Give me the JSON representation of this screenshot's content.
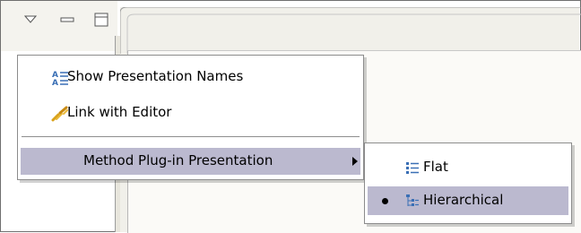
{
  "view_toolbar": {
    "menu_icon": "view-menu-triangle-icon",
    "minimize_icon": "minimize-icon",
    "maximize_icon": "maximize-icon"
  },
  "menu": {
    "items": [
      {
        "label": "Show Presentation Names",
        "icon": "presentation-names-icon"
      },
      {
        "label": "Link with Editor",
        "icon": "link-with-editor-icon"
      },
      {
        "label": "Method Plug-in Presentation",
        "icon": "submenu-arrow-icon",
        "highlighted": true
      }
    ]
  },
  "submenu": {
    "items": [
      {
        "label": "Flat",
        "icon": "flat-list-icon",
        "selected": false
      },
      {
        "label": "Hierarchical",
        "icon": "hierarchical-tree-icon",
        "selected": true,
        "highlighted": true
      }
    ]
  },
  "colors": {
    "highlight": "#bbb9cf",
    "toolbar_bg": "#f4f3ee",
    "tab_bg": "#f1f0ea"
  }
}
